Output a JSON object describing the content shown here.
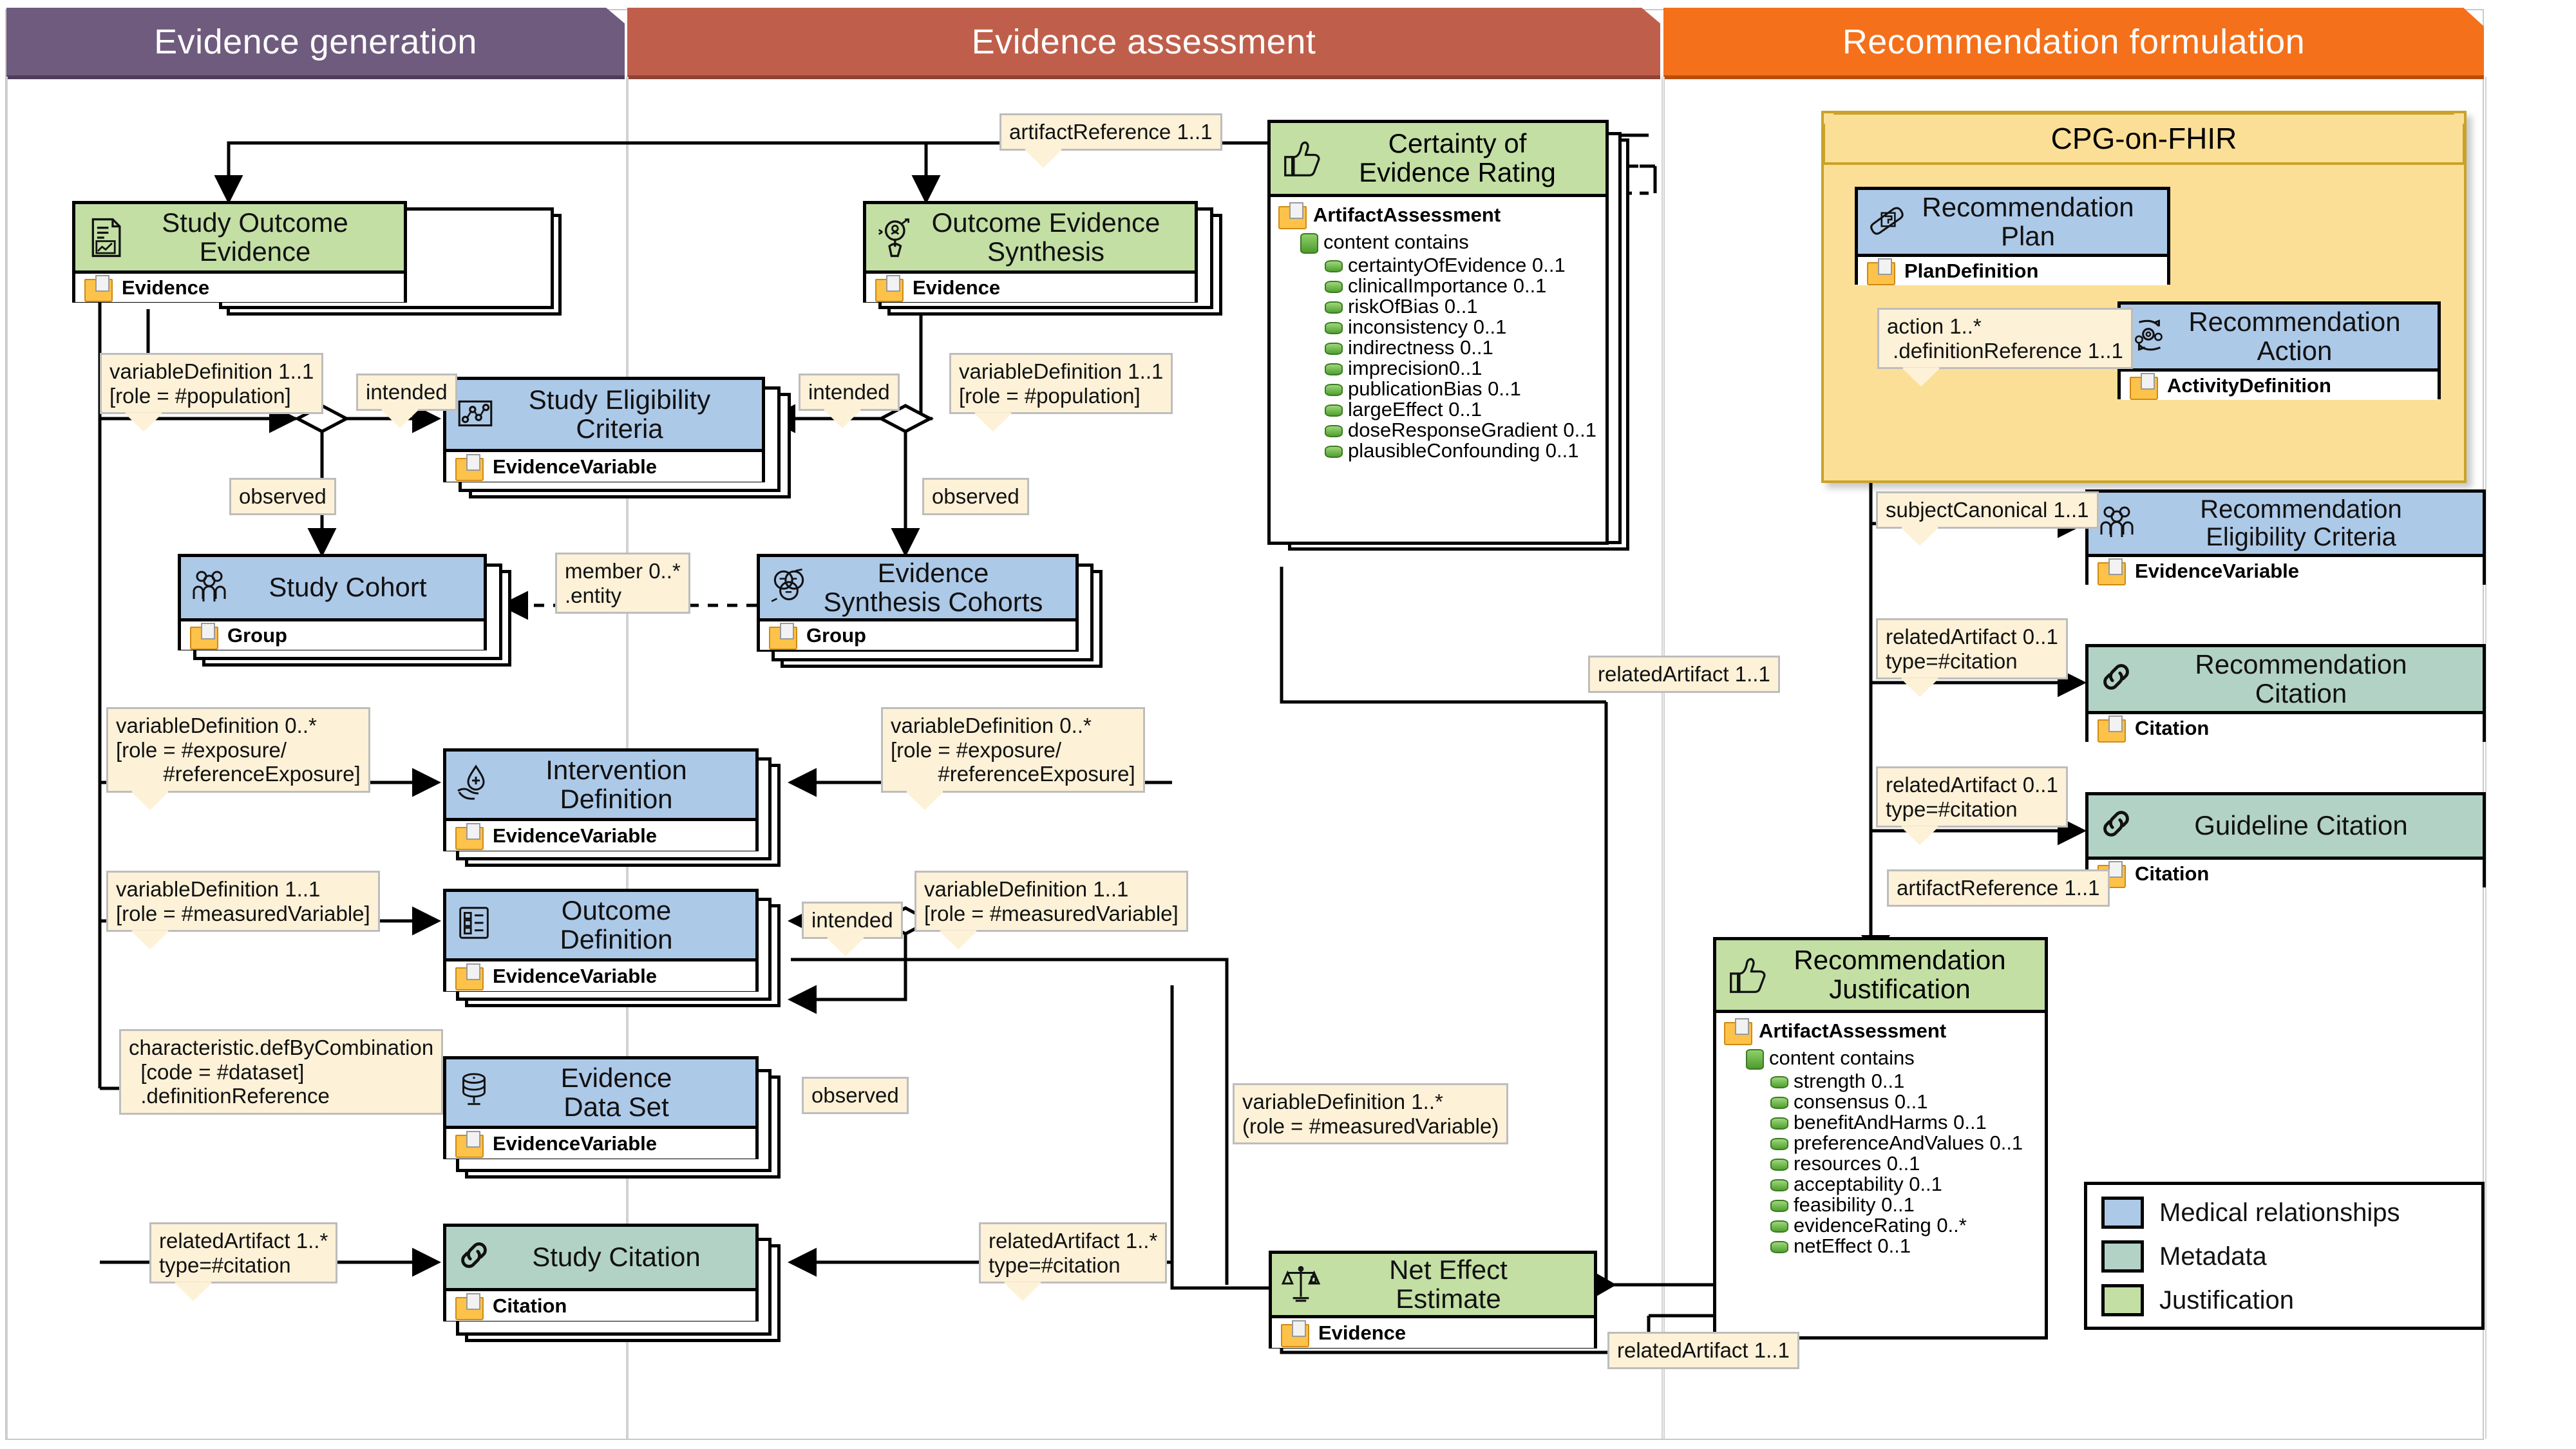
{
  "lanes": [
    {
      "label": "Evidence generation",
      "color": "#6f5b7e"
    },
    {
      "label": "Evidence assessment",
      "color": "#bf5f4b"
    },
    {
      "label": "Recommendation formulation",
      "color": "#f4701a"
    }
  ],
  "legend": {
    "items": [
      {
        "label": "Medical relationships",
        "color": "#adc9e8"
      },
      {
        "label": "Metadata",
        "color": "#b3d2c6"
      },
      {
        "label": "Justification",
        "color": "#c3dfa4"
      }
    ]
  },
  "package": {
    "title": "CPG-on-FHIR"
  },
  "classes": {
    "study_outcome_evidence": {
      "title": "Study Outcome\nEvidence",
      "resource": "Evidence",
      "icon": "document-chart-icon",
      "fill": "green"
    },
    "outcome_evidence_synth": {
      "title": "Outcome Evidence\nSynthesis",
      "resource": "Evidence",
      "icon": "magnifier-search-icon",
      "fill": "green"
    },
    "study_eligibility": {
      "title": "Study Eligibility\nCriteria",
      "resource": "EvidenceVariable",
      "icon": "scatter-plot-icon",
      "fill": "blue"
    },
    "study_cohort": {
      "title": "Study Cohort",
      "resource": "Group",
      "icon": "people-group-icon",
      "fill": "blue"
    },
    "evidence_synth_cohorts": {
      "title": "Evidence\nSynthesis Cohorts",
      "resource": "Group",
      "icon": "venn-diagram-icon",
      "fill": "blue"
    },
    "intervention_definition": {
      "title": "Intervention\nDefinition",
      "resource": "EvidenceVariable",
      "icon": "hand-drop-medical-icon",
      "fill": "blue"
    },
    "outcome_definition": {
      "title": "Outcome\nDefinition",
      "resource": "EvidenceVariable",
      "icon": "checklist-icon",
      "fill": "blue"
    },
    "evidence_data_set": {
      "title": "Evidence\nData Set",
      "resource": "EvidenceVariable",
      "icon": "database-icon",
      "fill": "blue"
    },
    "study_citation": {
      "title": "Study Citation",
      "resource": "Citation",
      "icon": "link-chain-icon",
      "fill": "teal"
    },
    "net_effect_estimate": {
      "title": "Net Effect\nEstimate",
      "resource": "Evidence",
      "icon": "balance-scale-icon",
      "fill": "green"
    },
    "recommendation_plan": {
      "title": "Recommendation\nPlan",
      "resource": "PlanDefinition",
      "icon": "blueprint-plan-icon",
      "fill": "blue"
    },
    "recommendation_action": {
      "title": "Recommendation\nAction",
      "resource": "ActivityDefinition",
      "icon": "gears-cycle-icon",
      "fill": "blue"
    },
    "recommendation_eligibility": {
      "title": "Recommendation\nEligibility Criteria",
      "resource": "EvidenceVariable",
      "icon": "people-group-icon",
      "fill": "blue"
    },
    "recommendation_citation": {
      "title": "Recommendation\nCitation",
      "resource": "Citation",
      "icon": "link-chain-icon",
      "fill": "teal"
    },
    "guideline_citation": {
      "title": "Guideline Citation",
      "resource": "Citation",
      "icon": "link-chain-icon",
      "fill": "teal"
    }
  },
  "certainty_of_evidence_rating": {
    "title": "Certainty of\nEvidence Rating",
    "icon": "thumbs-up-icon",
    "resource": "ArtifactAssessment",
    "content_label": "content contains",
    "items": [
      "certaintyOfEvidence 0..1",
      "clinicalImportance 0..1",
      "riskOfBias 0..1",
      "inconsistency 0..1",
      "indirectness 0..1",
      "imprecision0..1",
      "publicationBias 0..1",
      "largeEffect 0..1",
      "doseResponseGradient 0..1",
      "plausibleConfounding 0..1"
    ]
  },
  "recommendation_justification": {
    "title": "Recommendation\nJustification",
    "icon": "thumbs-up-icon",
    "resource": "ArtifactAssessment",
    "content_label": "content contains",
    "items": [
      "strength 0..1",
      "consensus 0..1",
      "benefitAndHarms 0..1",
      "preferenceAndValues 0..1",
      "resources 0..1",
      "acceptability 0..1",
      "feasibility 0..1",
      "evidenceRating 0..*",
      "netEffect 0..1"
    ]
  },
  "notes": {
    "artifact_ref_top": "artifactReference 1..1",
    "vardef_pop_left": "variableDefinition 1..1\n[role = #population]",
    "intended_left": "intended",
    "observed_left": "observed",
    "vardef_pop_mid": "variableDefinition 1..1\n[role = #population]",
    "intended_mid": "intended",
    "observed_mid": "observed",
    "member_entity": "member 0..*\n.entity",
    "vardef_exp_left": "variableDefinition 0..*\n[role = #exposure/\n        #referenceExposure]",
    "vardef_exp_mid": "variableDefinition 0..*\n[role = #exposure/\n        #referenceExposure]",
    "vardef_meas_left": "variableDefinition 1..1\n[role = #measuredVariable]",
    "vardef_meas_mid": "variableDefinition 1..1\n[role = #measuredVariable]",
    "intended_meas": "intended",
    "observed_dataset": "observed",
    "char_def_by_comb": "characteristic.defByCombination\n  [code = #dataset]\n  .definitionReference",
    "related_citation_left": "relatedArtifact 1..*\ntype=#citation",
    "related_citation_mid": "relatedArtifact 1..*\ntype=#citation",
    "vardef_meas_net": "variableDefinition 1..*\n(role = #measuredVariable)",
    "related_artifact_11": "relatedArtifact 1..1",
    "related_artifact_net": "relatedArtifact 1..1",
    "action_def_ref": "action 1..*\n .definitionReference 1..1",
    "subject_canonical": "subjectCanonical 1..1",
    "related_artifact_rec": "relatedArtifact 0..1\ntype=#citation",
    "related_artifact_gl": "relatedArtifact 0..1\ntype=#citation",
    "artifact_ref_just": "artifactReference 1..1"
  }
}
